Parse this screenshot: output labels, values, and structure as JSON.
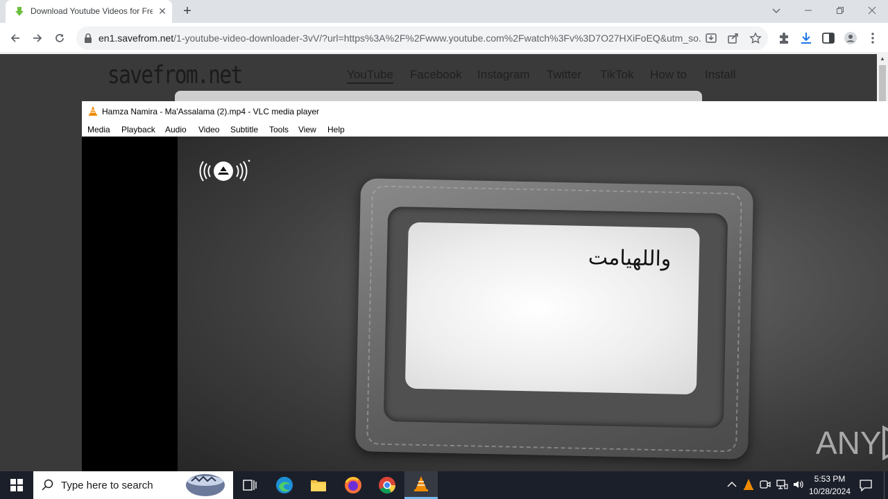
{
  "browser": {
    "tab_title": "Download Youtube Videos for Free",
    "tab_close": "✕",
    "new_tab": "+",
    "url_host": "en1.savefrom.net",
    "url_path": "/1-youtube-video-downloader-3vV/?url=https%3A%2F%2Fwww.youtube.com%2Fwatch%3Fv%3D7O27HXiFoEQ&utm_so...",
    "icons": [
      "back-icon",
      "forward-icon",
      "reload-icon",
      "lock-icon",
      "download-page-icon",
      "share-icon",
      "star-icon",
      "extensions-icon",
      "downloads-icon",
      "side-panel-icon",
      "profile-icon",
      "menu-icon"
    ]
  },
  "page": {
    "logo": "savefrom.net",
    "nav": [
      "YouTube",
      "Facebook",
      "Instagram",
      "Twitter",
      "TikTok",
      "How to",
      "Install"
    ]
  },
  "vlc": {
    "title": "Hamza Namira - Ma'Assalama  (2).mp4 - VLC media player",
    "menu": [
      "Media",
      "Playback",
      "Audio",
      "Video",
      "Subtitle",
      "Tools",
      "View",
      "Help"
    ],
    "card_text": "واللهيامت",
    "watermark": "ANY RUN"
  },
  "taskbar": {
    "search_placeholder": "Type here to search",
    "time": "5:53 PM",
    "date": "10/28/2024",
    "apps": [
      "task-view-icon",
      "edge-icon",
      "file-explorer-icon",
      "firefox-icon",
      "chrome-icon",
      "vlc-icon"
    ],
    "active_app": "vlc-icon"
  }
}
